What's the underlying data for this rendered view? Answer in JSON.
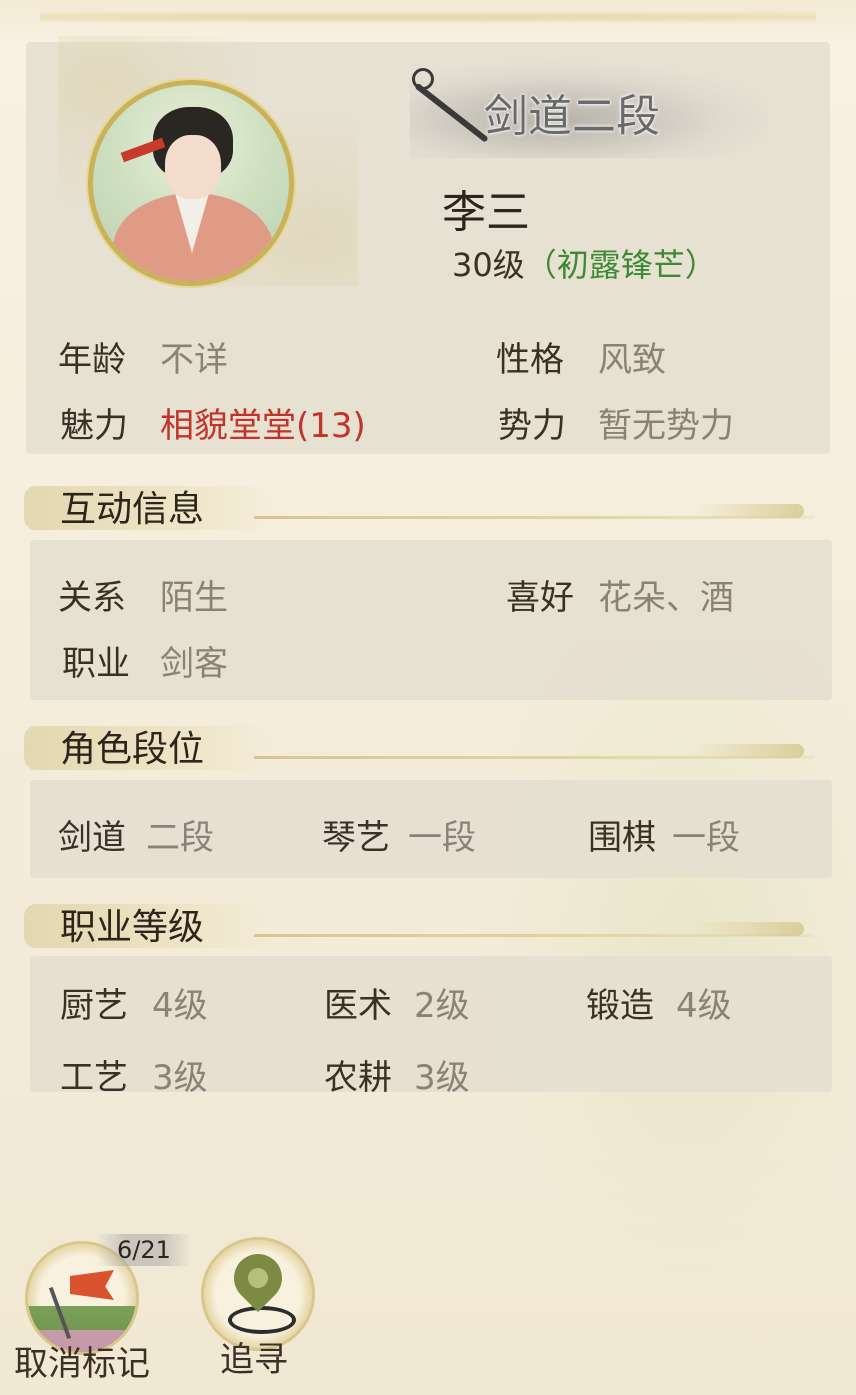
{
  "profile": {
    "rank_badge": "剑道二段",
    "name": "李三",
    "level": "30级",
    "level_title": "（初露锋芒）"
  },
  "basic": {
    "age_label": "年龄",
    "age_value": "不详",
    "personality_label": "性格",
    "personality_value": "风致",
    "charm_label": "魅力",
    "charm_value": "相貌堂堂(13)",
    "faction_label": "势力",
    "faction_value": "暂无势力"
  },
  "interaction": {
    "title": "互动信息",
    "relation_label": "关系",
    "relation_value": "陌生",
    "hobby_label": "喜好",
    "hobby_value": "花朵、酒",
    "job_label": "职业",
    "job_value": "剑客"
  },
  "ranks": {
    "title": "角色段位",
    "items": [
      {
        "label": "剑道",
        "value": "二段"
      },
      {
        "label": "琴艺",
        "value": "一段"
      },
      {
        "label": "围棋",
        "value": "一段"
      }
    ]
  },
  "jobs": {
    "title": "职业等级",
    "items": [
      {
        "label": "厨艺",
        "value": "4级"
      },
      {
        "label": "医术",
        "value": "2级"
      },
      {
        "label": "锻造",
        "value": "4级"
      },
      {
        "label": "工艺",
        "value": "3级"
      },
      {
        "label": "农耕",
        "value": "3级"
      }
    ]
  },
  "actions": {
    "unmark_label": "取消标记",
    "mark_count": "6/21",
    "track_label": "追寻"
  },
  "colors": {
    "highlight_red": "#c0342b",
    "highlight_green": "#3e8a34"
  }
}
